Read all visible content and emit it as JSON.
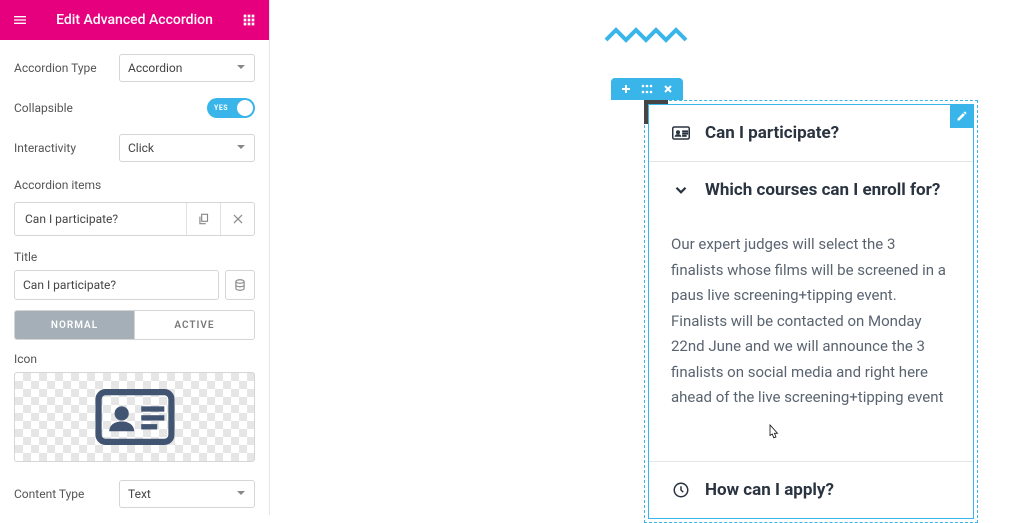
{
  "header": {
    "title": "Edit Advanced Accordion"
  },
  "controls": {
    "accordion_type": {
      "label": "Accordion Type",
      "value": "Accordion"
    },
    "collapsible": {
      "label": "Collapsible",
      "value": "YES"
    },
    "interactivity": {
      "label": "Interactivity",
      "value": "Click"
    },
    "items_label": "Accordion items",
    "item": {
      "header": "Can I participate?",
      "title_label": "Title",
      "title_value": "Can I participate?",
      "tabs": {
        "normal": "NORMAL",
        "active": "ACTIVE"
      },
      "icon_label": "Icon"
    },
    "content_type": {
      "label": "Content Type",
      "value": "Text"
    }
  },
  "preview": {
    "items": [
      {
        "title": "Can I participate?"
      },
      {
        "title": "Which courses can I enroll for?",
        "body": "Our expert judges will select the 3 finalists whose films will be screened in a paus live screening+tipping event. Finalists will be contacted on Monday 22nd June and we will announce the 3 finalists on social media and right here ahead of the live screening+tipping event"
      },
      {
        "title": "How can I apply?"
      }
    ]
  }
}
